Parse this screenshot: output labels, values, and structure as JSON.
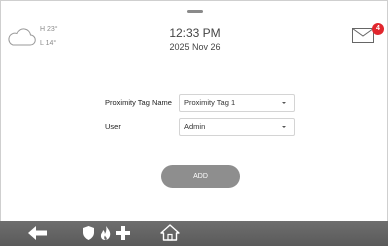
{
  "header": {
    "weather": {
      "high": "H 23°",
      "low": "L 14°",
      "icon": "cloud-icon"
    },
    "clock": {
      "time": "12:33 PM",
      "date": "2025 Nov 26"
    },
    "mail": {
      "icon": "envelope-icon",
      "unread_count": "4",
      "badge_color": "#e1262d"
    }
  },
  "form": {
    "proximity_tag_label": "Proximity Tag Name",
    "proximity_tag_value": "Proximity Tag 1",
    "user_label": "User",
    "user_value": "Admin",
    "add_button": "ADD"
  },
  "navbar": {
    "items": [
      {
        "icon": "back-arrow-icon"
      },
      {
        "icon": "shield-icon"
      },
      {
        "icon": "flame-icon"
      },
      {
        "icon": "medical-cross-icon"
      },
      {
        "icon": "home-icon"
      }
    ]
  }
}
